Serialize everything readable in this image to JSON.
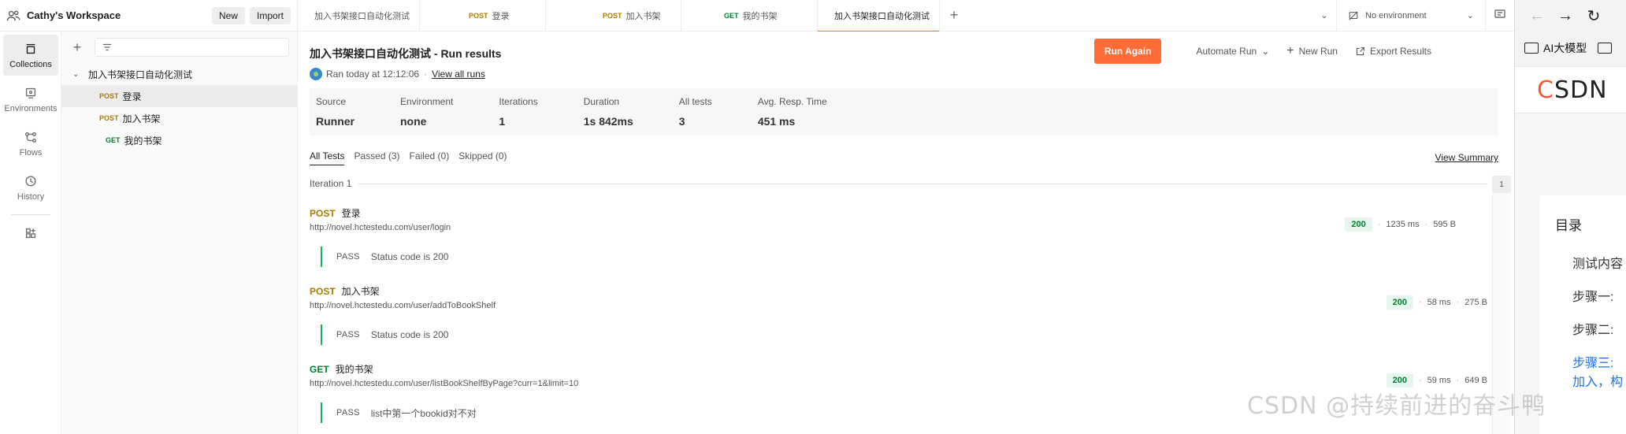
{
  "workspace": {
    "name": "Cathy's Workspace",
    "new_label": "New",
    "import_label": "Import"
  },
  "rail": [
    {
      "label": "Collections",
      "icon": "collections-icon",
      "active": true
    },
    {
      "label": "Environments",
      "icon": "environments-icon",
      "active": false
    },
    {
      "label": "Flows",
      "icon": "flows-icon",
      "active": false
    },
    {
      "label": "History",
      "icon": "history-icon",
      "active": false
    }
  ],
  "sidebar": {
    "collection": "加入书架接口自动化测试",
    "requests": [
      {
        "method": "POST",
        "name": "登录",
        "selected": true
      },
      {
        "method": "POST",
        "name": "加入书架",
        "selected": false
      },
      {
        "method": "GET",
        "name": "我的书架",
        "selected": false
      }
    ]
  },
  "tabs": [
    {
      "method": "",
      "label": "加入书架接口自动化测试",
      "icon": "collection-icon",
      "active": false
    },
    {
      "method": "POST",
      "label": "登录",
      "active": false
    },
    {
      "method": "POST",
      "label": "加入书架",
      "active": false
    },
    {
      "method": "GET",
      "label": "我的书架",
      "active": false
    },
    {
      "method": "",
      "label": "加入书架接口自动化测试",
      "icon": "runner-icon",
      "active": true
    }
  ],
  "environment": {
    "label": "No environment"
  },
  "run": {
    "title": "加入书架接口自动化测试 - Run results",
    "ran_text": "Ran today at 12:12:06",
    "view_all": "View all runs",
    "run_again": "Run Again",
    "automate": "Automate Run",
    "new_run": "New Run",
    "export": "Export Results",
    "stats": [
      {
        "label": "Source",
        "value": "Runner"
      },
      {
        "label": "Environment",
        "value": "none"
      },
      {
        "label": "Iterations",
        "value": "1"
      },
      {
        "label": "Duration",
        "value": "1s 842ms"
      },
      {
        "label": "All tests",
        "value": "3"
      },
      {
        "label": "Avg. Resp. Time",
        "value": "451 ms"
      }
    ],
    "filters": [
      "All Tests",
      "Passed (3)",
      "Failed (0)",
      "Skipped (0)"
    ],
    "view_summary": "View Summary",
    "iteration_label": "Iteration 1",
    "iteration_badge": "1",
    "results": [
      {
        "method": "POST",
        "name": "登录",
        "url": "http://novel.hctestedu.com/user/login",
        "status": "200",
        "time": "1235 ms",
        "size": "595 B",
        "test_status": "PASS",
        "test_name": "Status code is 200"
      },
      {
        "method": "POST",
        "name": "加入书架",
        "url": "http://novel.hctestedu.com/user/addToBookShelf",
        "status": "200",
        "time": "58 ms",
        "size": "275 B",
        "test_status": "PASS",
        "test_name": "Status code is 200"
      },
      {
        "method": "GET",
        "name": "我的书架",
        "url": "http://novel.hctestedu.com/user/listBookShelfByPage?curr=1&limit=10",
        "status": "200",
        "time": "59 ms",
        "size": "649 B",
        "test_status": "PASS",
        "test_name": "list中第一个bookid对不对"
      }
    ]
  },
  "browser": {
    "bookmark": "AI大模型",
    "logo_c": "C",
    "logo_rest": "SDN",
    "toc_title": "目录",
    "toc_items": [
      "测试内容",
      "步骤一:",
      "步骤二:",
      "步骤三:"
    ],
    "toc_sub": "加入，构",
    "watermark": "CSDN @持续前进的奋斗鸭"
  },
  "colors": {
    "accent": "#ff6c37",
    "post": "#ad7a03",
    "get": "#007f31",
    "pass": "#0cbb52",
    "csdn": "#fc5531"
  }
}
